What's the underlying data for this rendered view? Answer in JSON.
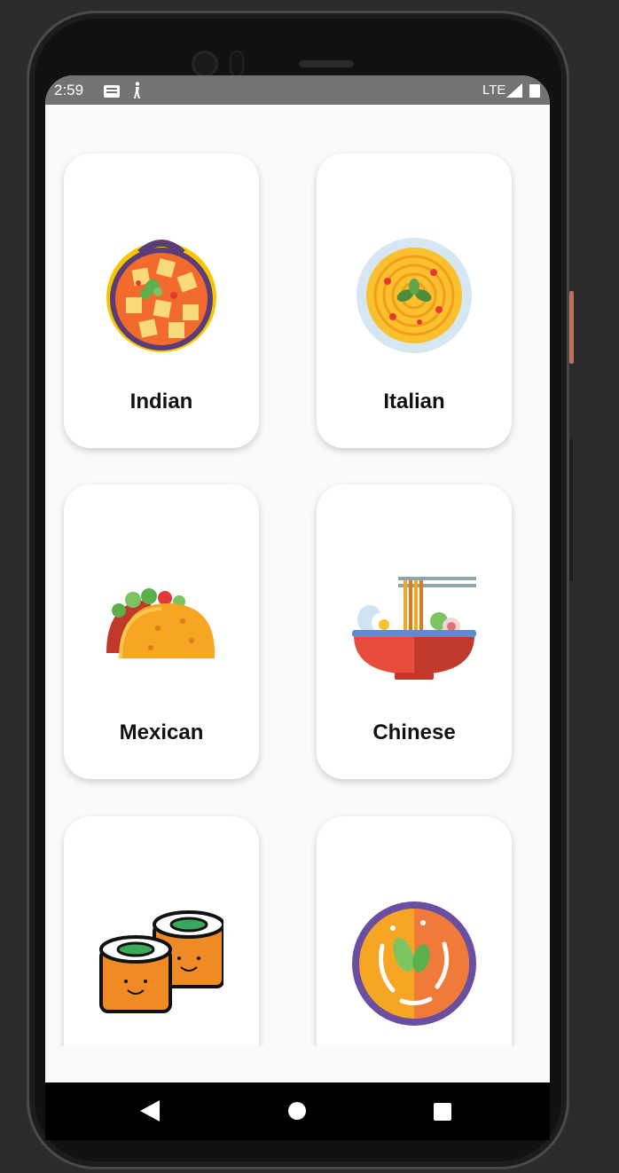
{
  "status_bar": {
    "time": "2:59",
    "network": "LTE",
    "icons": [
      "notification-icon",
      "accessibility-icon",
      "signal-icon",
      "battery-icon"
    ]
  },
  "categories": [
    {
      "label": "Indian",
      "icon": "indian-curry-icon"
    },
    {
      "label": "Italian",
      "icon": "pasta-plate-icon"
    },
    {
      "label": "Mexican",
      "icon": "taco-icon"
    },
    {
      "label": "Chinese",
      "icon": "noodle-bowl-icon"
    },
    {
      "label": "",
      "icon": "sushi-roll-icon"
    },
    {
      "label": "",
      "icon": "soup-bowl-icon"
    }
  ],
  "nav": {
    "icons": [
      "back-icon",
      "home-icon",
      "recents-icon"
    ]
  },
  "colors": {
    "screen_bg": "#fafafa",
    "status_bar": "#737373",
    "card_bg": "#ffffff",
    "nav_bar": "#000000"
  }
}
